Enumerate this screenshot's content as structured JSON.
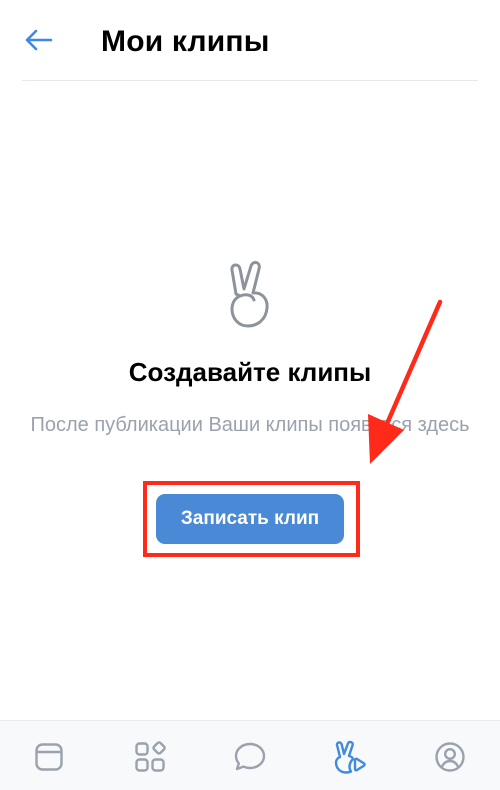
{
  "header": {
    "title": "Мои клипы",
    "back_icon": "arrow-left-icon"
  },
  "empty_state": {
    "icon": "victory-hand-icon",
    "title": "Создавайте клипы",
    "subtitle": "После публикации Ваши клипы появятся здесь"
  },
  "actions": {
    "record_label": "Записать клип"
  },
  "tabbar": {
    "items": [
      {
        "icon": "news-feed-icon",
        "active": false
      },
      {
        "icon": "services-icon",
        "active": false
      },
      {
        "icon": "messages-icon",
        "active": false
      },
      {
        "icon": "clips-icon",
        "active": true
      },
      {
        "icon": "profile-icon",
        "active": false
      }
    ]
  },
  "colors": {
    "accent": "#4a89d6",
    "back_arrow": "#3f8ae0",
    "annotation": "#ff2a1a",
    "icon_inactive": "#99a2ad",
    "subtitle": "#99a2ad"
  }
}
